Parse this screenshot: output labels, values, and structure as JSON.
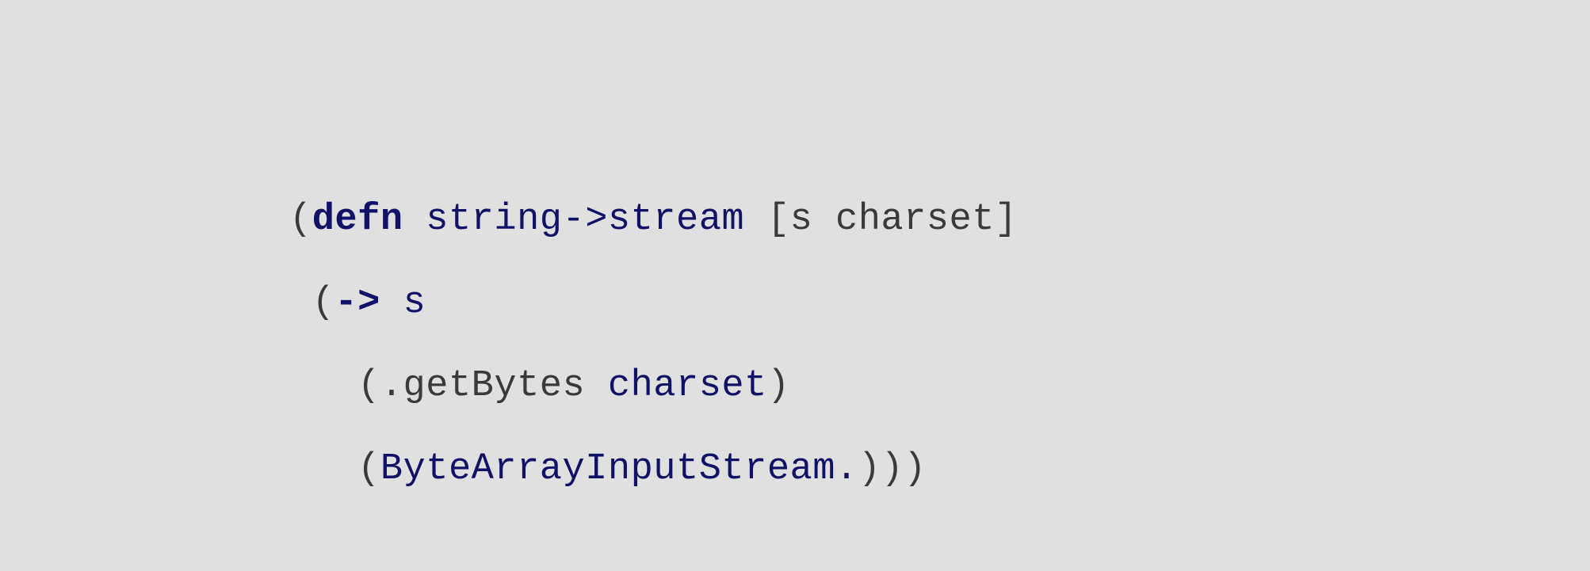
{
  "code": {
    "lines": [
      {
        "indent": "",
        "tokens": [
          {
            "cls": "tok-paren",
            "text": "("
          },
          {
            "cls": "tok-keyword",
            "text": "defn"
          },
          {
            "cls": "tok-default",
            "text": " "
          },
          {
            "cls": "tok-symbol",
            "text": "string->stream"
          },
          {
            "cls": "tok-default",
            "text": " "
          },
          {
            "cls": "tok-paren",
            "text": "["
          },
          {
            "cls": "tok-default",
            "text": "s charset"
          },
          {
            "cls": "tok-paren",
            "text": "]"
          }
        ]
      },
      {
        "indent": " ",
        "tokens": [
          {
            "cls": "tok-paren",
            "text": "("
          },
          {
            "cls": "tok-keyword",
            "text": "->"
          },
          {
            "cls": "tok-default",
            "text": " "
          },
          {
            "cls": "tok-symbol",
            "text": "s"
          }
        ]
      },
      {
        "indent": "   ",
        "tokens": [
          {
            "cls": "tok-paren",
            "text": "("
          },
          {
            "cls": "tok-default",
            "text": ".getBytes "
          },
          {
            "cls": "tok-symbol",
            "text": "charset"
          },
          {
            "cls": "tok-paren",
            "text": ")"
          }
        ]
      },
      {
        "indent": "   ",
        "tokens": [
          {
            "cls": "tok-paren",
            "text": "("
          },
          {
            "cls": "tok-symbol",
            "text": "ByteArrayInputStream."
          },
          {
            "cls": "tok-paren",
            "text": ")))"
          }
        ]
      }
    ]
  }
}
